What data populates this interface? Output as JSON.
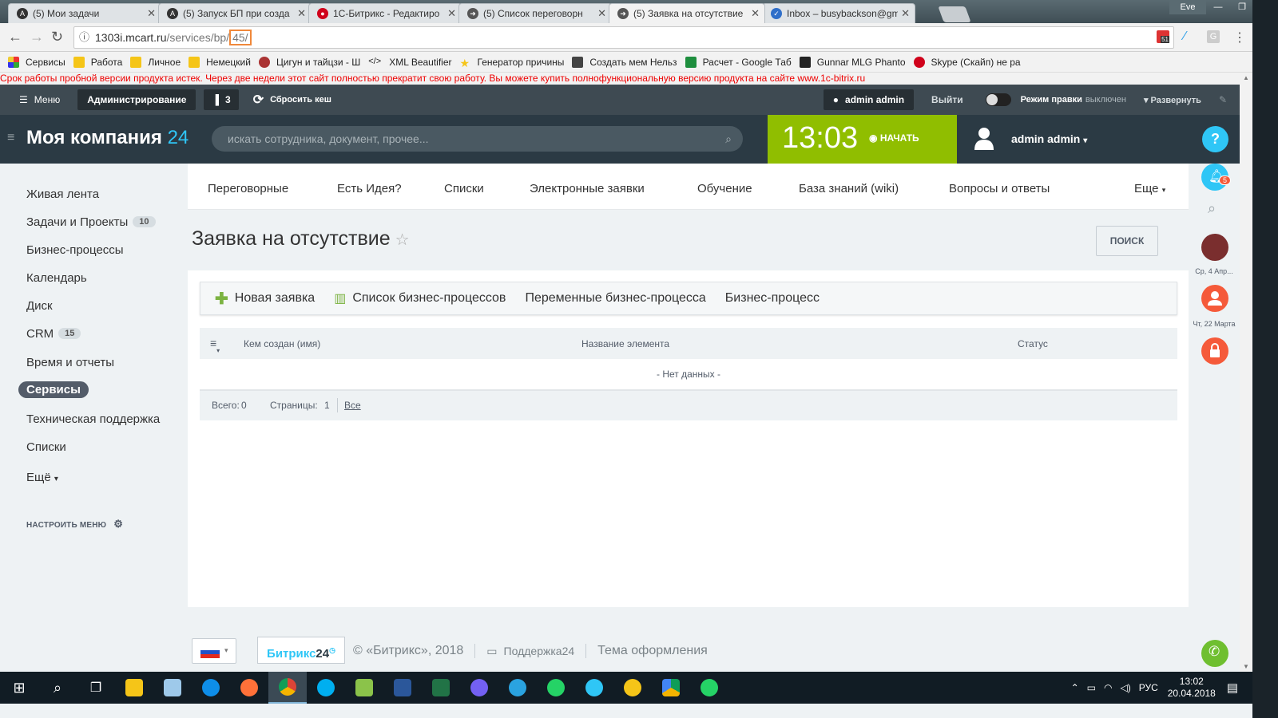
{
  "browser": {
    "tabs": [
      {
        "title": "(5) Мои задачи"
      },
      {
        "title": "(5) Запуск БП при созда"
      },
      {
        "title": "1С-Битрикс - Редактиро"
      },
      {
        "title": "(5) Список переговорн"
      },
      {
        "title": "(5) Заявка на отсутствие"
      },
      {
        "title": "Inbox – busybackson@gm"
      }
    ],
    "window_user": "Eve",
    "url_host": "1303i.mcart.ru",
    "url_path": "/services/bp/",
    "url_highlight": "45/",
    "extension_badge": "51",
    "bookmarks": [
      "Сервисы",
      "Работа",
      "Личное",
      "Немецкий",
      "Цигун и тайцзи - Ш",
      "XML Beautifier",
      "Генератор причины",
      "Создать мем Нельз",
      "Расчет - Google Таб",
      "Gunnar MLG Phanto",
      "Skype (Скайп) не ра"
    ]
  },
  "trial_notice": "Срок работы пробной версии продукта истек. Через две недели этот сайт полностью прекратит свою работу. Вы можете купить полнофункциональную версию продукта на сайте www.1c-bitrix.ru",
  "admin_panel": {
    "menu": "Меню",
    "admin": "Администрирование",
    "badge_count": "3",
    "reset_cache": "Сбросить кеш",
    "user": "admin admin",
    "logout": "Выйти",
    "edit_mode": "Режим правки",
    "edit_mode_state": "выключен",
    "expand": "Развернуть"
  },
  "header": {
    "logo": "Моя компания",
    "logo_num": "24",
    "search_placeholder": "искать сотрудника, документ, прочее...",
    "time": "13:03",
    "start": "НАЧАТЬ",
    "user": "admin admin",
    "help": "?"
  },
  "left_menu": {
    "items": [
      {
        "label": "Живая лента",
        "count": ""
      },
      {
        "label": "Задачи и Проекты",
        "count": "10"
      },
      {
        "label": "Бизнес-процессы",
        "count": ""
      },
      {
        "label": "Календарь",
        "count": ""
      },
      {
        "label": "Диск",
        "count": ""
      },
      {
        "label": "CRM",
        "count": "15"
      },
      {
        "label": "Время и отчеты",
        "count": ""
      },
      {
        "label": "Сервисы",
        "count": ""
      },
      {
        "label": "Техническая поддержка",
        "count": ""
      },
      {
        "label": "Списки",
        "count": ""
      },
      {
        "label": "Ещё",
        "count": ""
      }
    ],
    "configure": "НАСТРОИТЬ МЕНЮ"
  },
  "top_menu": [
    "Переговорные",
    "Есть Идея?",
    "Списки",
    "Электронные заявки",
    "Обучение",
    "База знаний (wiki)",
    "Вопросы и ответы",
    "Еще"
  ],
  "page": {
    "title": "Заявка на отсутствие",
    "search_button": "ПОИСК",
    "toolbar": {
      "new": "Новая заявка",
      "list": "Список бизнес-процессов",
      "vars": "Переменные бизнес-процесса",
      "bp": "Бизнес-процесс"
    },
    "grid": {
      "columns": [
        "Кем создан (имя)",
        "Название элемента",
        "Статус"
      ],
      "empty": "- Нет данных -",
      "total_label": "Всего:",
      "total": "0",
      "pages_label": "Страницы:",
      "page": "1",
      "all": "Все"
    }
  },
  "footer": {
    "b24": "Битрикс",
    "b24_num": "24",
    "copyright": "© «Битрикс», 2018",
    "support": "Поддержка24",
    "theme": "Тема оформления"
  },
  "right_bar": {
    "notif_count": "5",
    "date1": "Ср, 4 Апр...",
    "date2": "Чт, 22 Марта"
  },
  "taskbar": {
    "lang": "РУС",
    "time": "13:02",
    "date": "20.04.2018"
  },
  "colors": {
    "accent": "#2fc6f6",
    "timer_bg": "#90be00",
    "header_bg": "#2b3a44",
    "trial_text": "#ee0000"
  }
}
